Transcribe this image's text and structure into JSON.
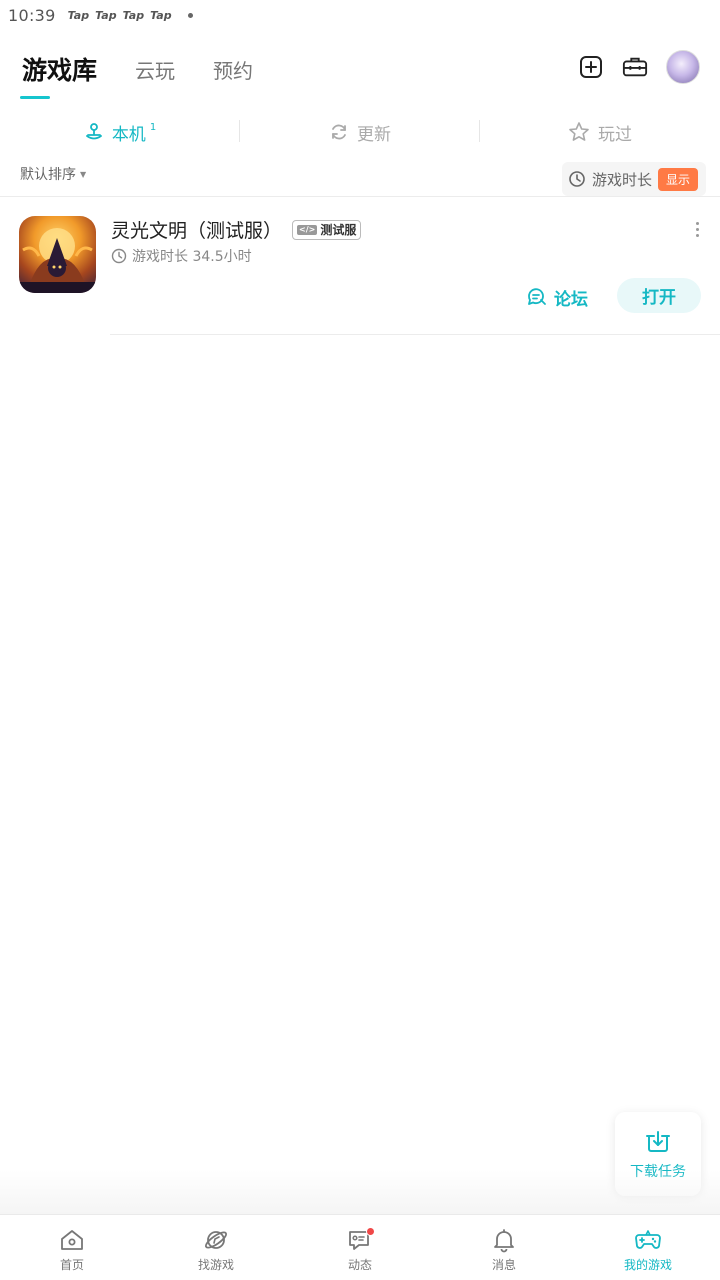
{
  "status_bar": {
    "time": "10:39",
    "apps": [
      "Tap",
      "Tap",
      "Tap",
      "Tap"
    ]
  },
  "header": {
    "tabs": [
      {
        "label": "游戏库",
        "active": true
      },
      {
        "label": "云玩",
        "active": false
      },
      {
        "label": "预约",
        "active": false
      }
    ],
    "actions": [
      "add-icon",
      "toolbox-icon",
      "avatar"
    ]
  },
  "filter_tabs": [
    {
      "label": "本机",
      "count": "1",
      "icon": "local-icon",
      "active": true
    },
    {
      "label": "更新",
      "count": "",
      "icon": "refresh-icon",
      "active": false
    },
    {
      "label": "玩过",
      "count": "",
      "icon": "star-icon",
      "active": false
    }
  ],
  "sort": {
    "label": "默认排序",
    "playtime_label": "游戏时长",
    "show_badge": "显示"
  },
  "games": [
    {
      "title": "灵光文明（测试服）",
      "badge": "测试服",
      "playtime": "游戏时长 34.5小时",
      "forum_label": "论坛",
      "open_label": "打开"
    }
  ],
  "download_float": {
    "label": "下载任务",
    "icon": "download-icon"
  },
  "bottom_nav": [
    {
      "label": "首页",
      "icon": "home-icon",
      "active": false
    },
    {
      "label": "找游戏",
      "icon": "planet-icon",
      "active": false
    },
    {
      "label": "动态",
      "icon": "moments-icon",
      "active": false,
      "has_dot": true
    },
    {
      "label": "消息",
      "icon": "bell-icon",
      "active": false
    },
    {
      "label": "我的游戏",
      "icon": "gamepad-icon",
      "active": true
    }
  ],
  "colors": {
    "accent": "#15b8c4",
    "badge_orange": "#ff7a45",
    "notify_red": "#f04848"
  }
}
